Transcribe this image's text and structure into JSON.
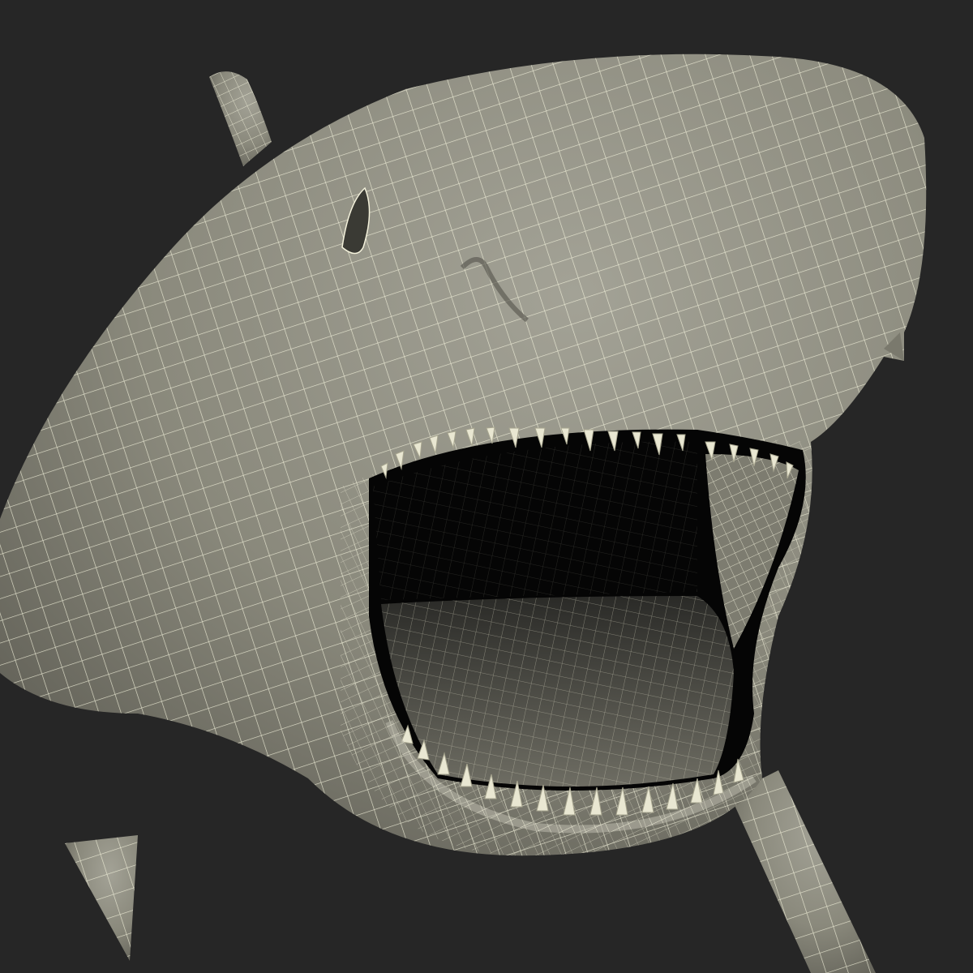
{
  "scene": {
    "subject": "great-white-shark-wireframe",
    "render_style": "wireframe-over-shaded-mesh"
  },
  "colors": {
    "background": "#262626",
    "skin": "#8a897c",
    "skin_light": "#a3a296",
    "skin_shadow": "#5e5d54",
    "wire": "#f4f2dc",
    "mouth_dark": "#050505",
    "mouth_floor": "#4e4d47",
    "teeth": "#e9e7d2"
  }
}
